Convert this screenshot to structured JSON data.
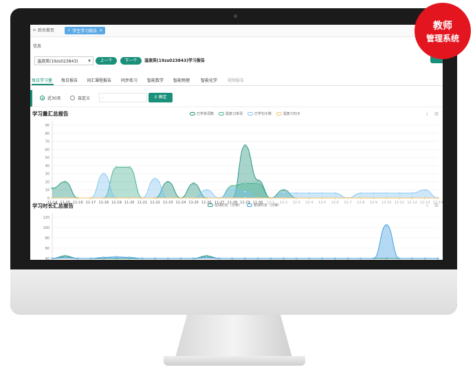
{
  "tabs": {
    "home": "后台首页",
    "active": "学生学习报告"
  },
  "info_label": "信息",
  "student_select": {
    "value": "温淑英(19zs023843)"
  },
  "nav": {
    "prev": "上一个",
    "next": "下一个"
  },
  "report_title": "温淑英(19zs023843)学习报告",
  "subtabs": [
    "每日学习量",
    "每日报告",
    "词汇课程报告",
    "同步练习",
    "智能数学",
    "智能物理",
    "智能化学",
    "视频报告"
  ],
  "filter": {
    "last30": "近30天",
    "custom": "自定义",
    "date_placeholder": "-",
    "confirm": "确定"
  },
  "badge": {
    "line1": "教师",
    "line2": "管理系统"
  },
  "colors": {
    "teal": "#1a8f7a",
    "blue": "#3a9ae0",
    "light_blue": "#8fcbf2",
    "orange": "#f3c26a",
    "red": "#e3151f"
  },
  "chart_data": [
    {
      "type": "area",
      "title": "学习量汇总报告",
      "ylim": [
        0,
        90
      ],
      "yticks": [
        "0",
        "10",
        "20",
        "30",
        "40",
        "50",
        "60",
        "70",
        "80",
        "90"
      ],
      "categories": [
        "11-14",
        "11-15",
        "11-16",
        "11-17",
        "11-18",
        "11-19",
        "11-20",
        "11-21",
        "11-22",
        "11-23",
        "11-24",
        "11-25",
        "11-26",
        "11-27",
        "11-28",
        "11-29",
        "11-30",
        "12-1",
        "12-2",
        "12-3",
        "12-4",
        "12-5",
        "12-6",
        "12-7",
        "12-8",
        "12-9",
        "12-10",
        "12-11",
        "12-12",
        "12-13",
        "12-14"
      ],
      "grid": true,
      "legend_position": "top-center",
      "series": [
        {
          "name": "已学单词数",
          "color": "#1a8f7a",
          "values": [
            12,
            20,
            0,
            0,
            0,
            0,
            0,
            0,
            0,
            20,
            0,
            18,
            0,
            0,
            0,
            65,
            22,
            0,
            10,
            0,
            0,
            0,
            0,
            0,
            0,
            0,
            0,
            0,
            0,
            0,
            0
          ]
        },
        {
          "name": "需复习单词",
          "color": "#3fae8e",
          "values": [
            0,
            0,
            0,
            0,
            0,
            38,
            38,
            0,
            0,
            0,
            0,
            0,
            0,
            0,
            15,
            18,
            18,
            0,
            0,
            0,
            0,
            0,
            0,
            0,
            0,
            0,
            0,
            0,
            0,
            0,
            0
          ]
        },
        {
          "name": "已学句子数",
          "color": "#7fc3f0",
          "values": [
            0,
            0,
            0,
            0,
            30,
            0,
            0,
            0,
            24,
            0,
            0,
            0,
            10,
            0,
            12,
            8,
            0,
            0,
            6,
            6,
            6,
            6,
            6,
            0,
            6,
            6,
            6,
            6,
            6,
            10,
            0
          ]
        },
        {
          "name": "需复习句子",
          "color": "#f3c26a",
          "values": [
            0,
            0,
            0,
            0,
            0,
            0,
            0,
            0,
            0,
            0,
            0,
            0,
            0,
            0,
            0,
            0,
            0,
            0,
            0,
            0,
            0,
            0,
            0,
            0,
            0,
            0,
            0,
            0,
            0,
            0,
            0
          ]
        }
      ]
    },
    {
      "type": "area",
      "title": "学习时长汇总报告",
      "ylim": [
        40,
        120
      ],
      "yticks": [
        "40",
        "60",
        "80",
        "100",
        "120"
      ],
      "grid": true,
      "legend_position": "top-center",
      "series": [
        {
          "name": "在线时长（分钟）",
          "color": "#1a8f7a",
          "values": [
            40,
            45,
            40,
            40,
            40,
            40,
            40,
            40,
            40,
            40,
            40,
            40,
            45,
            40,
            40,
            40,
            40,
            40,
            40,
            40,
            40,
            40,
            40,
            40,
            40,
            40,
            40,
            40,
            40,
            40,
            40
          ]
        },
        {
          "name": "有效时长（分钟）",
          "color": "#3a9ae0",
          "values": [
            40,
            42,
            40,
            40,
            42,
            43,
            42,
            40,
            40,
            40,
            40,
            40,
            42,
            40,
            40,
            40,
            40,
            40,
            40,
            40,
            40,
            40,
            40,
            40,
            40,
            40,
            105,
            40,
            40,
            40,
            40
          ]
        }
      ]
    }
  ]
}
